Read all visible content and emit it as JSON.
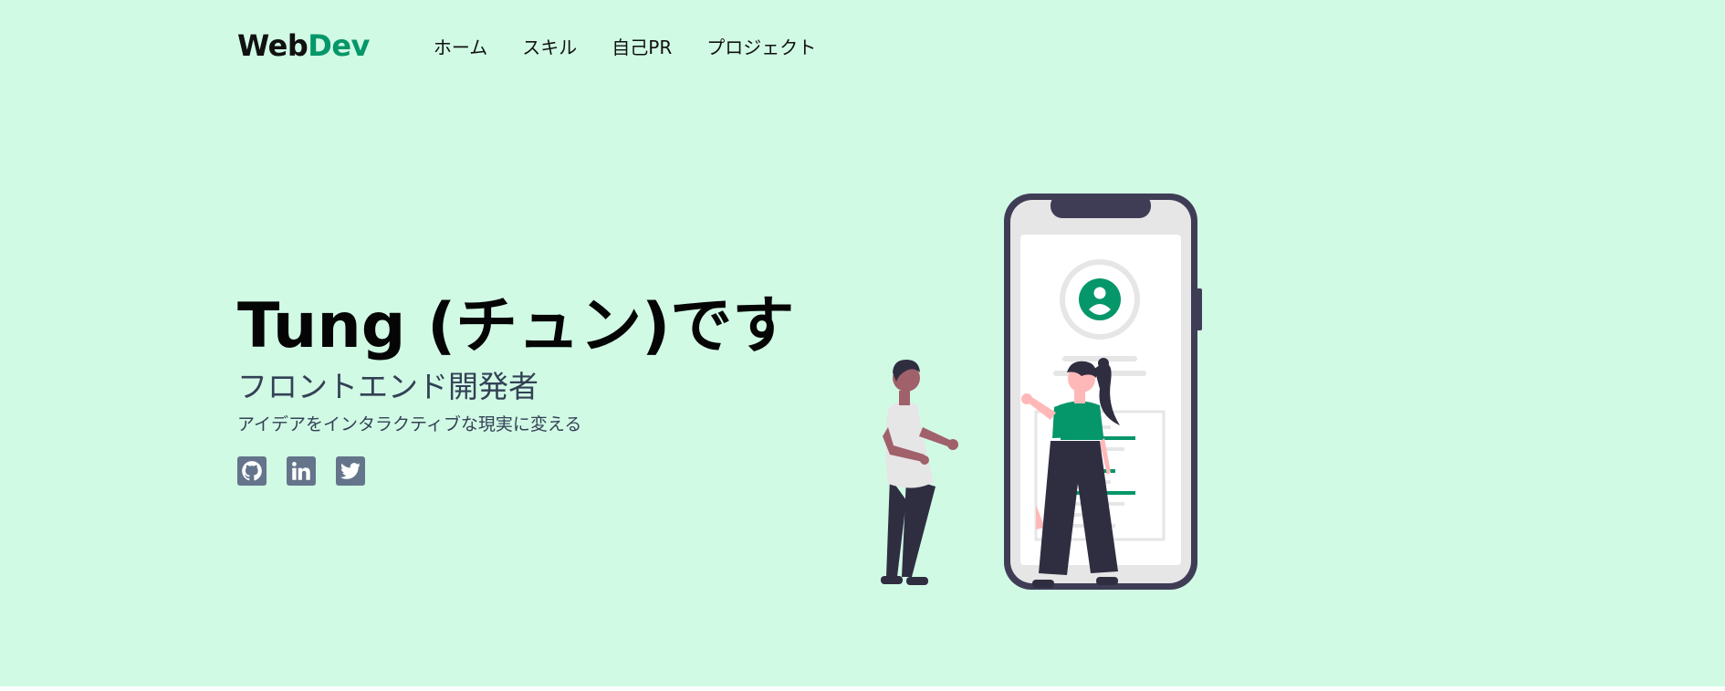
{
  "header": {
    "logo": {
      "part1": "Web",
      "part2": "Dev"
    },
    "nav": [
      {
        "label": "ホーム"
      },
      {
        "label": "スキル"
      },
      {
        "label": "自己PR"
      },
      {
        "label": "プロジェクト"
      }
    ]
  },
  "hero": {
    "title": "Tung (チュン)です",
    "subtitle": "フロントエンド開発者",
    "tagline": "アイデアをインタラクティブな現実に変える",
    "socials": [
      {
        "icon": "github-icon"
      },
      {
        "icon": "linkedin-icon"
      },
      {
        "icon": "twitter-icon"
      }
    ]
  },
  "colors": {
    "background": "#d1fae5",
    "accent": "#059669",
    "icon": "#64748b",
    "text": "#111111"
  }
}
